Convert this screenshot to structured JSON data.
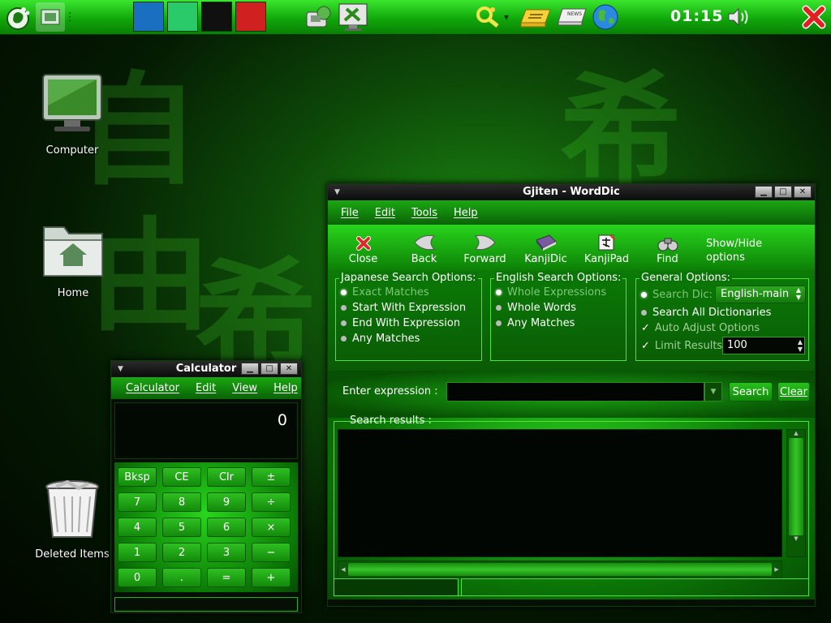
{
  "panel": {
    "clock": "01:15",
    "tile_colors": [
      "#1a6fc0",
      "#2ac96a",
      "#101010",
      "#d02020"
    ]
  },
  "desktop": {
    "icons": [
      {
        "label": "Computer",
        "icon": "computer-icon"
      },
      {
        "label": "Home",
        "icon": "home-folder-icon"
      },
      {
        "label": "Deleted Items",
        "icon": "trash-icon"
      }
    ]
  },
  "calculator": {
    "title": "Calculator",
    "menu": [
      "Calculator",
      "Edit",
      "View",
      "Help"
    ],
    "display": "0",
    "rows": [
      [
        "Bksp",
        "CE",
        "Clr",
        "±"
      ],
      [
        "7",
        "8",
        "9",
        "÷"
      ],
      [
        "4",
        "5",
        "6",
        "×"
      ],
      [
        "1",
        "2",
        "3",
        "−"
      ],
      [
        "0",
        ".",
        "=",
        "+"
      ]
    ]
  },
  "gjiten": {
    "title": "Gjiten - WordDic",
    "menu": [
      "File",
      "Edit",
      "Tools",
      "Help"
    ],
    "toolbar": {
      "close": "Close",
      "back": "Back",
      "forward": "Forward",
      "kanjidic": "KanjiDic",
      "kanjipad": "KanjiPad",
      "find": "Find",
      "showhide_1": "Show/Hide",
      "showhide_2": "options"
    },
    "japanese": {
      "title": "Japanese Search Options:",
      "options": [
        "Exact Matches",
        "Start With Expression",
        "End With Expression",
        "Any Matches"
      ]
    },
    "english": {
      "title": "English Search Options:",
      "options": [
        "Whole Expressions",
        "Whole Words",
        "Any Matches"
      ]
    },
    "general": {
      "title": "General Options:",
      "search_dic_label": "Search Dic:",
      "search_dic_value": "English-main",
      "search_all": "Search All Dictionaries",
      "auto_adjust": "Auto Adjust Options",
      "limit_results": "Limit Results:",
      "limit_value": "100"
    },
    "enter_expression": "Enter expression :",
    "search_button": "Search",
    "clear_button": "Clear",
    "results_title": "Search results :"
  }
}
